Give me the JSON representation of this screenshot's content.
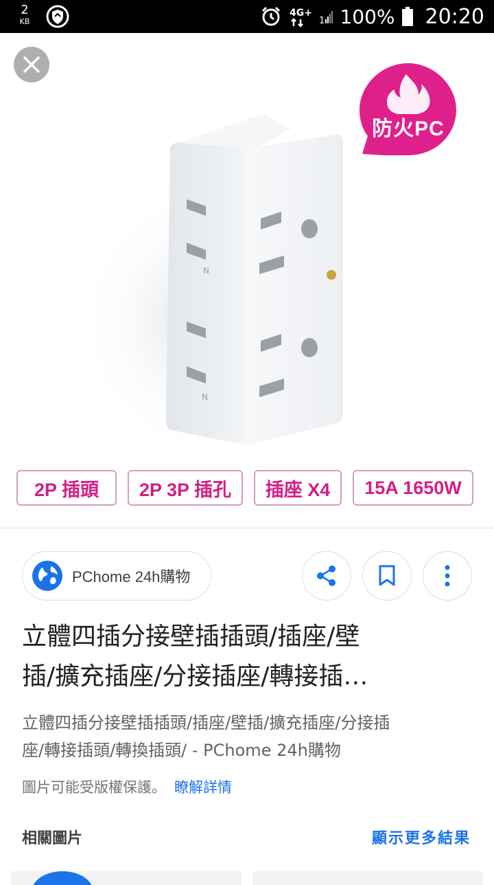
{
  "status_bar": {
    "data_speed_value": "2",
    "data_speed_unit": "KB",
    "network_label": "4G+",
    "signal_digit": "1",
    "battery_percent": "100%",
    "time": "20:20",
    "icons": [
      "shield-icon",
      "alarm-icon",
      "network-icon",
      "signal-icon",
      "battery-icon"
    ]
  },
  "image": {
    "badge_text": "防火PC",
    "features": [
      "2P 插頭",
      "2P 3P 插孔",
      "插座 X4",
      "15A 1650W"
    ],
    "accent_color": "#e0208a"
  },
  "source": {
    "name": "PChome 24h購物"
  },
  "result": {
    "title_line1": "立體四插分接壁插插頭/插座/壁",
    "title_line2": "插/擴充插座/分接插座/轉接插…",
    "subtitle_line1": "立體四插分接壁插插頭/插座/壁插/擴充插座/分接插",
    "subtitle_line2": "座/轉接插頭/轉換插頭/ - PChome 24h購物",
    "copyright": "圖片可能受版權保護。",
    "learn_more": "瞭解詳情"
  },
  "related": {
    "title": "相關圖片",
    "more_results": "顯示更多結果"
  }
}
